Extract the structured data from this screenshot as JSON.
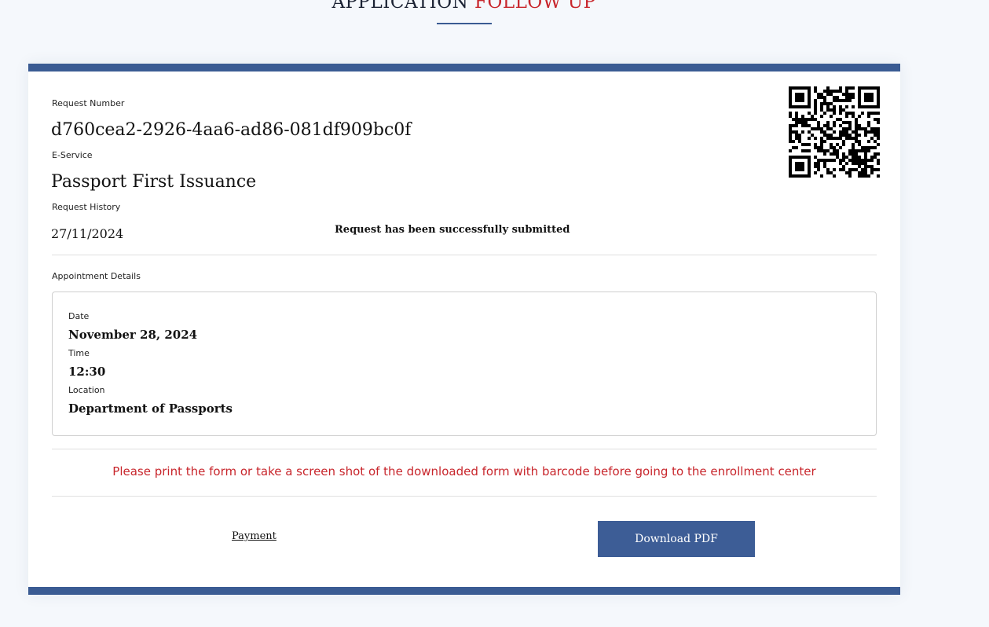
{
  "header": {
    "title_main": "APPLICATION",
    "title_accent": "FOLLOW UP"
  },
  "request": {
    "number_label": "Request Number",
    "number_value": "d760cea2-2926-4aa6-ad86-081df909bc0f",
    "service_label": "E-Service",
    "service_value": "Passport First Issuance",
    "history_label": "Request History",
    "history_date": "27/11/2024",
    "history_status": "Request has been successfully submitted"
  },
  "appointment": {
    "section_label": "Appointment Details",
    "date_label": "Date",
    "date_value": "November 28, 2024",
    "time_label": "Time",
    "time_value": "12:30",
    "location_label": "Location",
    "location_value": "Department of Passports"
  },
  "notice": "Please print the form or take a screen shot of the downloaded form with barcode before going to the enrollment center",
  "actions": {
    "payment_label": "Payment",
    "download_label": "Download PDF"
  },
  "qr_icon": "qr-code",
  "colors": {
    "accent_red": "#c8262c",
    "brand_blue": "#3a5b93",
    "button_blue": "#3d5d96"
  }
}
